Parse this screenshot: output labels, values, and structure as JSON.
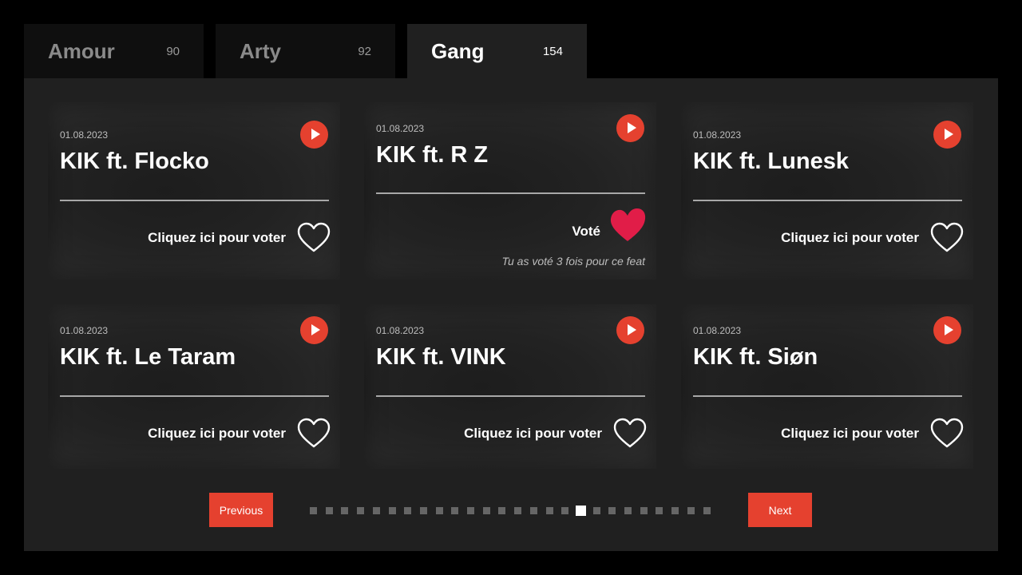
{
  "tabs": [
    {
      "name": "Amour",
      "count": "90",
      "active": false
    },
    {
      "name": "Arty",
      "count": "92",
      "active": false
    },
    {
      "name": "Gang",
      "count": "154",
      "active": true
    }
  ],
  "cards": [
    {
      "date": "01.08.2023",
      "title": "KIK ft. Flocko",
      "vote_label": "Cliquez ici pour voter",
      "voted": false
    },
    {
      "date": "01.08.2023",
      "title": "KIK ft. R Z",
      "vote_label": "Voté",
      "voted": true,
      "note": "Tu as voté 3 fois pour ce feat"
    },
    {
      "date": "01.08.2023",
      "title": "KIK ft. Lunesk",
      "vote_label": "Cliquez ici pour voter",
      "voted": false
    },
    {
      "date": "01.08.2023",
      "title": "KIK ft. Le Taram",
      "vote_label": "Cliquez ici pour voter",
      "voted": false
    },
    {
      "date": "01.08.2023",
      "title": "KIK ft. VINK",
      "vote_label": "Cliquez ici pour voter",
      "voted": false
    },
    {
      "date": "01.08.2023",
      "title": "KIK ft. Siøn",
      "vote_label": "Cliquez ici pour voter",
      "voted": false
    }
  ],
  "pagination": {
    "previous_label": "Previous",
    "next_label": "Next",
    "total_pages": 26,
    "current_page": 18
  },
  "colors": {
    "accent": "#e5412f",
    "heart_voted": "#e11d48",
    "background": "#000000",
    "panel": "#202020"
  },
  "icons": {
    "play": "play-icon",
    "heart_outline": "heart-outline-icon",
    "heart_filled": "heart-filled-icon"
  }
}
